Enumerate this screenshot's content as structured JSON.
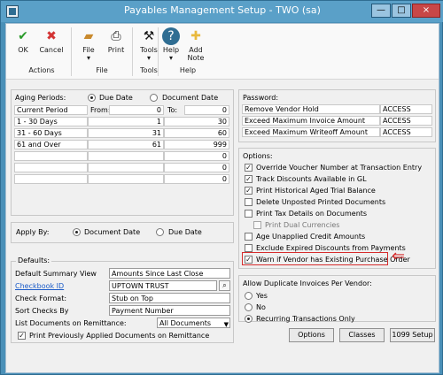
{
  "window": {
    "title": "Payables Management Setup  -  TWO (sa)"
  },
  "ribbon": {
    "actions": [
      {
        "label": "OK"
      },
      {
        "label": "Cancel"
      }
    ],
    "file": [
      {
        "label": "File"
      },
      {
        "label": "Print"
      }
    ],
    "tools": [
      {
        "label": "Tools"
      }
    ],
    "help": [
      {
        "label": "Help"
      },
      {
        "label": "Add\nNote"
      }
    ],
    "groups": [
      "Actions",
      "File",
      "Tools",
      "Help"
    ]
  },
  "aging": {
    "label": "Aging Periods:",
    "due_date": "Due Date",
    "document_date": "Document Date",
    "selected": "Due Date",
    "from": "From:",
    "to": "To:",
    "rows": [
      {
        "name": "Current Period",
        "from": "0",
        "to": "0"
      },
      {
        "name": "1 - 30 Days",
        "from": "1",
        "to": "30"
      },
      {
        "name": "31 - 60 Days",
        "from": "31",
        "to": "60"
      },
      {
        "name": "61 and Over",
        "from": "61",
        "to": "999"
      },
      {
        "name": "",
        "from": "",
        "to": "0"
      },
      {
        "name": "",
        "from": "",
        "to": "0"
      },
      {
        "name": "",
        "from": "",
        "to": "0"
      }
    ]
  },
  "apply_by": {
    "label": "Apply By:",
    "document_date": "Document Date",
    "due_date": "Due Date",
    "selected": "Document Date"
  },
  "defaults": {
    "title": "Defaults:",
    "summary_view_label": "Default Summary View",
    "summary_view": "Amounts Since Last Close",
    "checkbook_label": "Checkbook ID",
    "checkbook": "UPTOWN TRUST",
    "check_format_label": "Check Format:",
    "check_format": "Stub on Top",
    "sort_label": "Sort Checks By",
    "sort": "Payment Number",
    "list_label": "List Documents on Remittance:",
    "list": "All Documents",
    "print_prev": "Print Previously Applied Documents on Remittance"
  },
  "password": {
    "title": "Password:",
    "rows": [
      {
        "label": "Remove Vendor Hold",
        "value": "ACCESS"
      },
      {
        "label": "Exceed Maximum Invoice Amount",
        "value": "ACCESS"
      },
      {
        "label": "Exceed Maximum Writeoff Amount",
        "value": "ACCESS"
      }
    ]
  },
  "options": {
    "title": "Options:",
    "items": [
      {
        "label": "Override Voucher Number at Transaction Entry",
        "checked": true
      },
      {
        "label": "Track Discounts  Available in GL",
        "checked": true
      },
      {
        "label": "Print Historical  Aged Trial Balance",
        "checked": true
      },
      {
        "label": "Delete Unposted Printed Documents",
        "checked": false
      },
      {
        "label": "Print Tax Details on Documents",
        "checked": false
      },
      {
        "label": "Print Dual Currencies",
        "checked": false
      },
      {
        "label": "Age Unapplied Credit Amounts",
        "checked": false
      },
      {
        "label": "Exclude Expired Discounts from Payments",
        "checked": false
      },
      {
        "label": "Warn if Vendor has Existing Purchase Order",
        "checked": true
      }
    ]
  },
  "duplicates": {
    "title": "Allow Duplicate Invoices Per Vendor:",
    "yes": "Yes",
    "no": "No",
    "recurring": "Recurring Transactions Only",
    "selected": "Recurring Transactions Only"
  },
  "buttons": {
    "options": "Options",
    "classes": "Classes",
    "setup1099": "1099 Setup"
  },
  "colors": {
    "accent": "#4a90b8",
    "red_callout": "#d62c2c"
  }
}
